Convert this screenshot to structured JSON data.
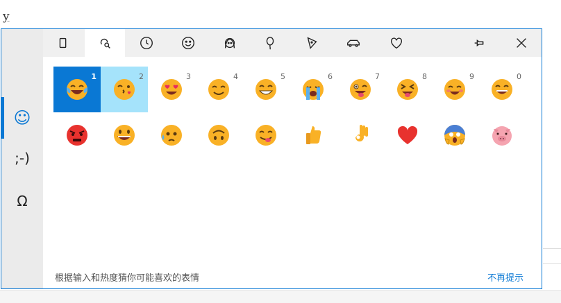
{
  "document": {
    "char": "y"
  },
  "sidebar": {
    "items": [
      {
        "name": "emoji",
        "glyph": "☺"
      },
      {
        "name": "kaomoji",
        "glyph": ";-)"
      },
      {
        "name": "symbols",
        "glyph": "Ω"
      }
    ]
  },
  "tabs": [
    {
      "name": "search-icon"
    },
    {
      "name": "recent-icon"
    },
    {
      "name": "smiley-icon"
    },
    {
      "name": "people-icon"
    },
    {
      "name": "balloon-icon"
    },
    {
      "name": "pizza-icon"
    },
    {
      "name": "car-icon"
    },
    {
      "name": "heart-icon"
    },
    {
      "name": "pin-icon"
    },
    {
      "name": "close-icon"
    }
  ],
  "emojis": {
    "row1": [
      {
        "name": "tears-of-joy",
        "num": "1"
      },
      {
        "name": "kissing-heart",
        "num": "2"
      },
      {
        "name": "heart-eyes",
        "num": "3"
      },
      {
        "name": "smiling-blush",
        "num": "4"
      },
      {
        "name": "grinning-teeth",
        "num": "5"
      },
      {
        "name": "loudly-crying",
        "num": "6"
      },
      {
        "name": "winking-tongue",
        "num": "7"
      },
      {
        "name": "squinting-tongue",
        "num": "8"
      },
      {
        "name": "blush-smile",
        "num": "9"
      },
      {
        "name": "grinning",
        "num": "0"
      }
    ],
    "row2": [
      {
        "name": "angry"
      },
      {
        "name": "grinning-big-eyes"
      },
      {
        "name": "sad-sweat"
      },
      {
        "name": "upside-down"
      },
      {
        "name": "yum"
      },
      {
        "name": "thumbs-up"
      },
      {
        "name": "ok-hand"
      },
      {
        "name": "red-heart"
      },
      {
        "name": "screaming"
      },
      {
        "name": "pig"
      }
    ]
  },
  "footer": {
    "hint": "根据输入和热度猜你可能喜欢的表情",
    "dismiss": "不再提示"
  },
  "colors": {
    "accent": "#0a78d4",
    "selected_light": "#a5e3fb",
    "emoji_face": "#f9b126"
  }
}
